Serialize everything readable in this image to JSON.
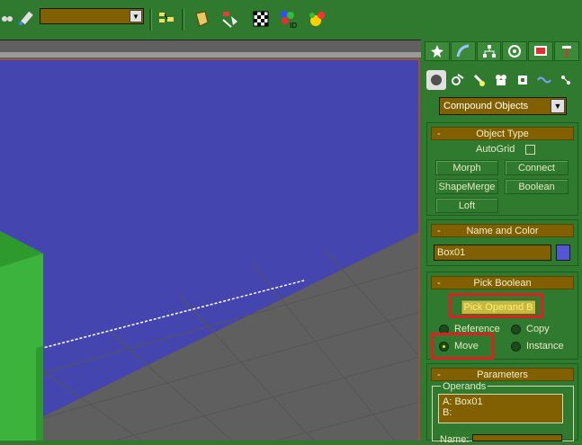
{
  "toolbar": {
    "selection_set_value": "",
    "icons": [
      "select-link-icon",
      "unlink-icon",
      "named-selection-icon",
      "mirror-icon",
      "align-icon",
      "material-editor-icon",
      "render-scene-icon",
      "object-id-icon",
      "teapot-render-icon"
    ]
  },
  "command_panel": {
    "tabs": [
      "create-tab-icon",
      "modify-tab-icon",
      "hierarchy-tab-icon",
      "motion-tab-icon",
      "display-tab-icon",
      "utilities-tab-icon"
    ],
    "subcategories": [
      "geometry-icon",
      "shapes-icon",
      "lights-icon",
      "cameras-icon",
      "helpers-icon",
      "space-warps-icon",
      "systems-icon"
    ],
    "category_dropdown": "Compound Objects",
    "object_type": {
      "title": "Object Type",
      "minus": "-",
      "autogrid_label": "AutoGrid",
      "buttons": [
        "Morph",
        "Connect",
        "ShapeMerge",
        "Boolean",
        "Loft"
      ]
    },
    "name_and_color": {
      "title": "Name and Color",
      "minus": "-",
      "name_value": "Box01",
      "color": "#5555d8"
    },
    "pick_boolean": {
      "title": "Pick Boolean",
      "minus": "-",
      "pick_button": "Pick Operand B",
      "options": {
        "reference": "Reference",
        "copy": "Copy",
        "move": "Move",
        "instance": "Instance"
      },
      "selected": "Move"
    },
    "parameters": {
      "title": "Parameters",
      "minus": "-",
      "operands_label": "Operands",
      "operands": [
        "A: Box01",
        "B:"
      ],
      "name_label": "Name:"
    }
  },
  "colors": {
    "panel_green": "#2f7a2f",
    "field_gold": "#806000",
    "viewport_blue": "#4545b0",
    "highlight_red": "#e02020",
    "object_green": "#3cb33c"
  }
}
